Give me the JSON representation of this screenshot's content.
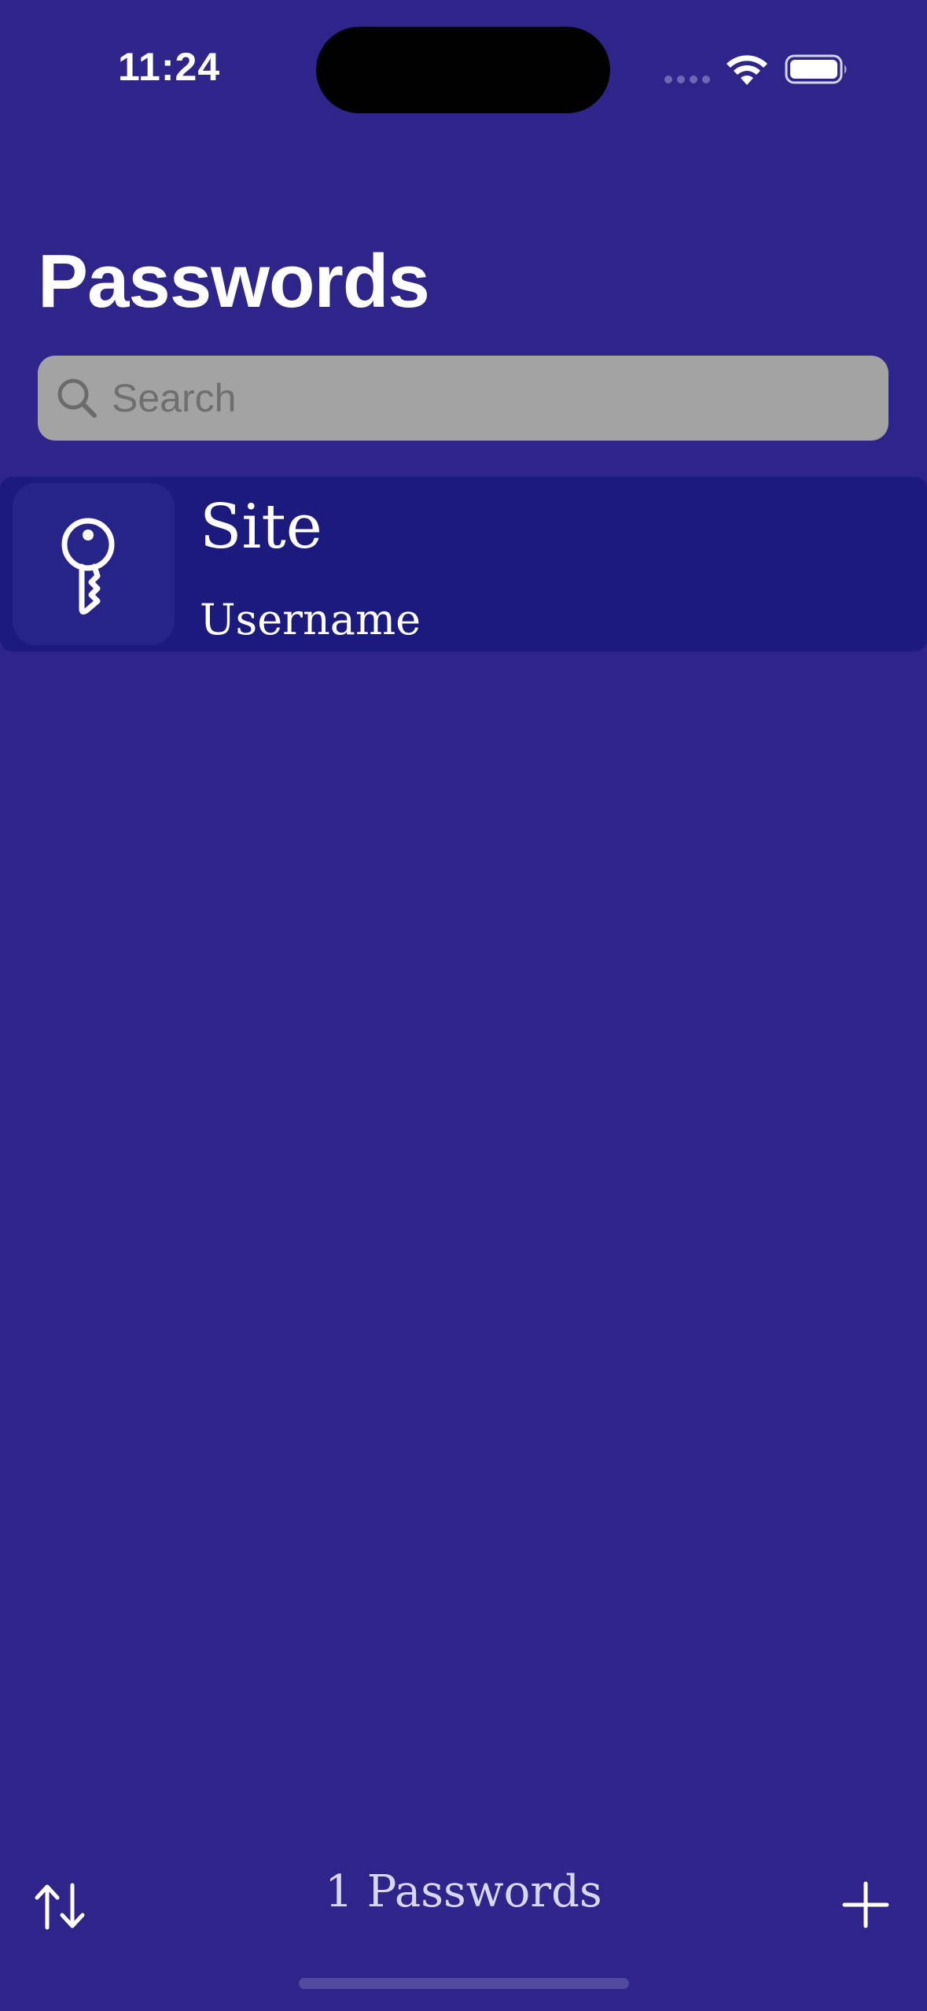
{
  "status_bar": {
    "time": "11:24",
    "icons": [
      "signal-dots-icon",
      "wifi-icon",
      "battery-icon"
    ]
  },
  "header": {
    "title": "Passwords"
  },
  "search": {
    "placeholder": "Search",
    "value": "",
    "icon": "magnifying-glass-icon"
  },
  "passwords": [
    {
      "site": "Site",
      "username": "Username",
      "icon": "key-icon"
    }
  ],
  "toolbar": {
    "count_label": "1 Passwords",
    "sort_icon": "sort-arrows-icon",
    "add_icon": "plus-icon"
  },
  "colors": {
    "background": "#2e2489",
    "row_background": "#1c1a7c",
    "search_background": "#a3a3a3",
    "text": "#ffffff"
  }
}
